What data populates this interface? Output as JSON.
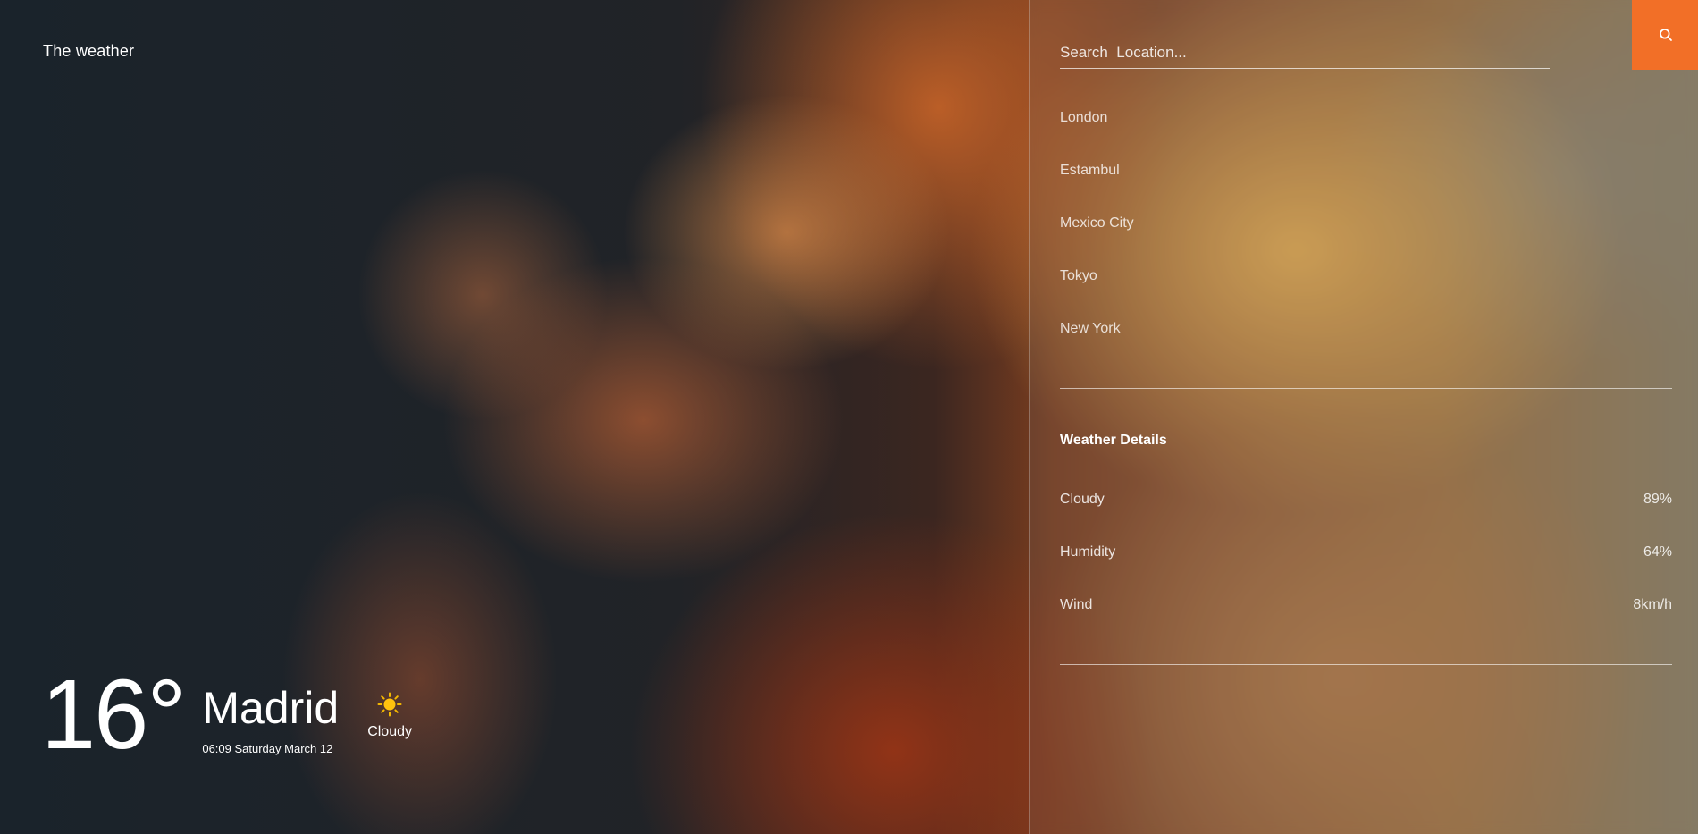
{
  "brand": "The weather",
  "current": {
    "temperature": "16°",
    "city": "Madrid",
    "datetime": "06:09 Saturday March 12",
    "condition": "Cloudy",
    "condition_icon": "sun-icon"
  },
  "search": {
    "placeholder": "Search  Location...",
    "value": "",
    "button_icon": "search-icon",
    "button_color": "#f26f27"
  },
  "locations": [
    "London",
    "Estambul",
    "Mexico City",
    "Tokyo",
    "New York"
  ],
  "details": {
    "title": "Weather Details",
    "rows": [
      {
        "label": "Cloudy",
        "value": "89%"
      },
      {
        "label": "Humidity",
        "value": "64%"
      },
      {
        "label": "Wind",
        "value": "8km/h"
      }
    ]
  }
}
